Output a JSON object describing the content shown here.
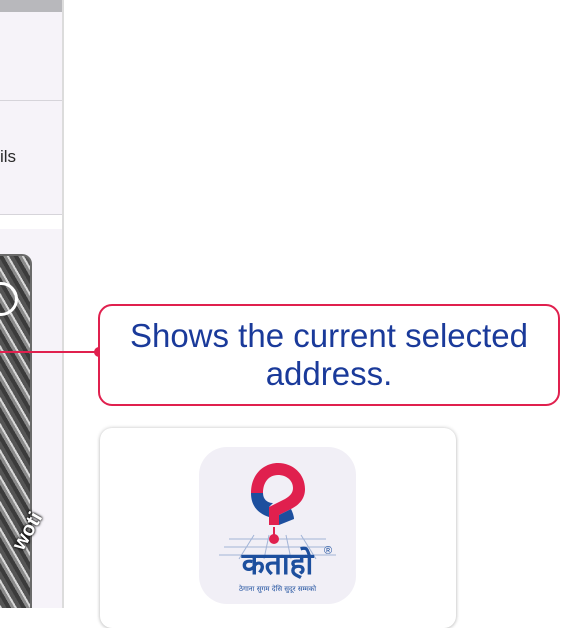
{
  "left_panel": {
    "details_label": "ils",
    "media_overlay_text": "woti"
  },
  "callout": {
    "text": "Shows the current selected address.",
    "color": "#e0204e"
  },
  "app_logo": {
    "brand": "कताहो",
    "reg_mark": "®",
    "tagline": "ठेगाना सुगम देसि सुदूर सम्मको"
  }
}
